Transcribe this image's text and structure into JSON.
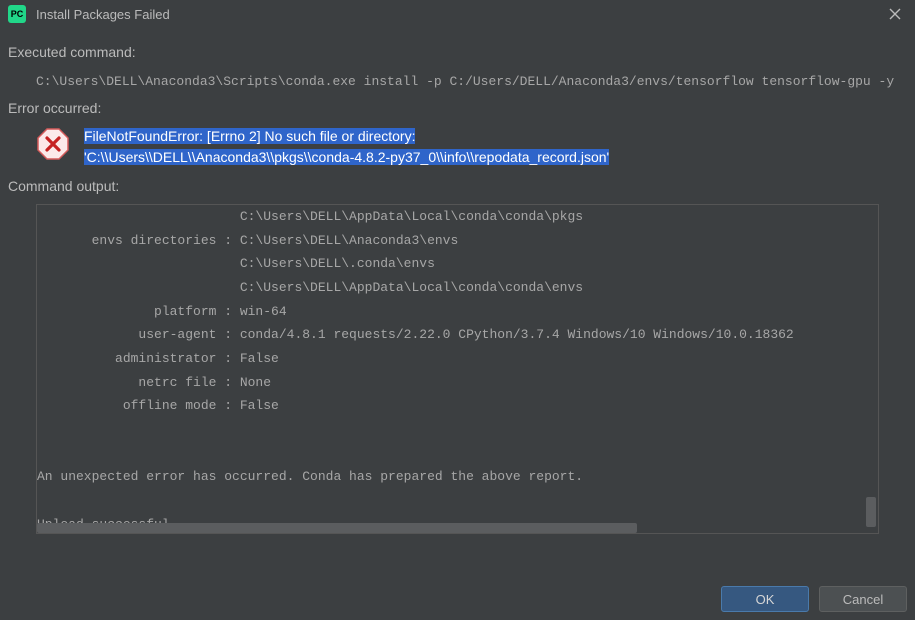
{
  "titlebar": {
    "app_abbr": "PC",
    "title": "Install Packages Failed"
  },
  "sections": {
    "executed_command": "Executed command:",
    "error_occurred": "Error occurred:",
    "command_output": "Command output:"
  },
  "command_text": "C:\\Users\\DELL\\Anaconda3\\Scripts\\conda.exe install -p C:/Users/DELL/Anaconda3/envs/tensorflow tensorflow-gpu -y",
  "error": {
    "line1": "FileNotFoundError: [Errno 2] No such file or directory:",
    "line2": "'C:\\\\Users\\\\DELL\\\\Anaconda3\\\\pkgs\\\\conda-4.8.2-py37_0\\\\info\\\\repodata_record.json'"
  },
  "output_text": "                          C:\\Users\\DELL\\AppData\\Local\\conda\\conda\\pkgs\n       envs directories : C:\\Users\\DELL\\Anaconda3\\envs\n                          C:\\Users\\DELL\\.conda\\envs\n                          C:\\Users\\DELL\\AppData\\Local\\conda\\conda\\envs\n               platform : win-64\n             user-agent : conda/4.8.1 requests/2.22.0 CPython/3.7.4 Windows/10 Windows/10.0.18362\n          administrator : False\n             netrc file : None\n           offline mode : False\n\n\nAn unexpected error has occurred. Conda has prepared the above report.\n\nUpload successful.",
  "buttons": {
    "ok": "OK",
    "cancel": "Cancel"
  }
}
